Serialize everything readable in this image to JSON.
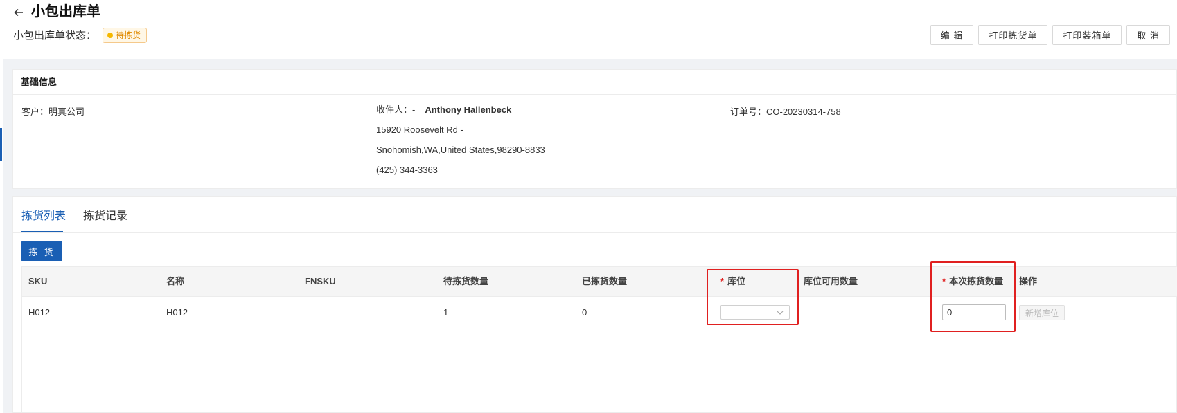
{
  "header": {
    "back_icon": "arrow-left-icon",
    "title": "小包出库单",
    "status_label": "小包出库单状态：",
    "status_badge": "待拣货",
    "status_color": "#f5b800",
    "actions": {
      "edit": "编 辑",
      "print_pick_list": "打印拣货单",
      "print_packing_list": "打印装箱单",
      "cancel": "取 消"
    }
  },
  "basic_info": {
    "title": "基础信息",
    "customer": "客户：明真公司",
    "recipient_label": "收件人：-",
    "recipient_name": "Anthony Hallenbeck",
    "address_line1": "15920 Roosevelt Rd -",
    "address_line2": "Snohomish,WA,United States,98290-8833",
    "phone": "(425) 344-3363",
    "order_no": "订单号：CO-20230314-758"
  },
  "pick": {
    "tabs": [
      "拣货列表",
      "拣货记录"
    ],
    "active_tab": 0,
    "pick_button": "拣 货",
    "columns": {
      "sku": "SKU",
      "name": "名称",
      "fnsku": "FNSKU",
      "pending_qty": "待拣货数量",
      "picked_qty": "已拣货数量",
      "location": "库位",
      "location_available": "库位可用数量",
      "this_pick_qty": "本次拣货数量",
      "actions": "操作"
    },
    "required_mark": "*",
    "rows": [
      {
        "sku": "H012",
        "name": "H012",
        "fnsku": "",
        "pending_qty": "1",
        "picked_qty": "0",
        "location": "",
        "location_available": "",
        "this_pick_qty": "0",
        "add_location": "新增库位"
      }
    ]
  },
  "colors": {
    "primary": "#1a5fb4",
    "highlight": "#e02020"
  }
}
